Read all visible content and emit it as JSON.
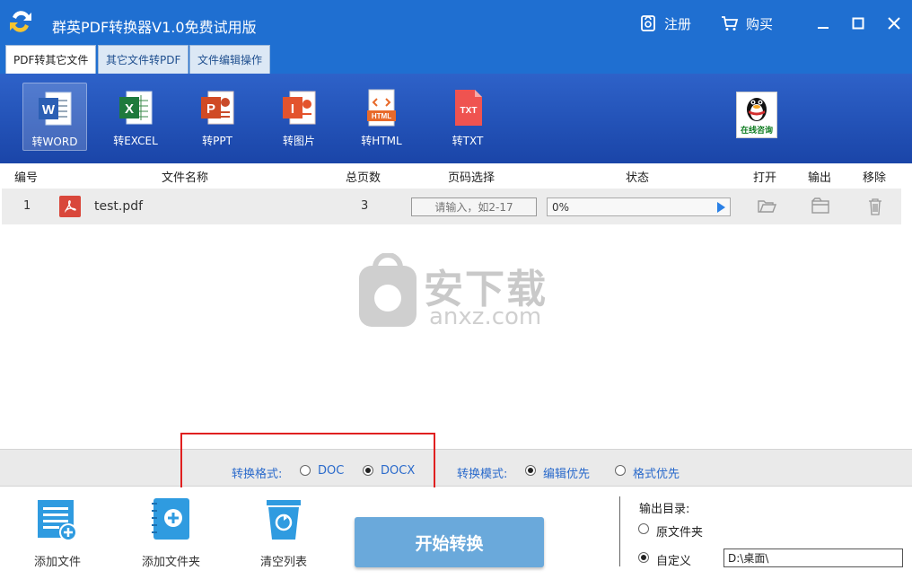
{
  "app": {
    "title": "群英PDF转换器V1.0免费试用版"
  },
  "titlebar": {
    "register_label": "注册",
    "buy_label": "购买"
  },
  "tabs": [
    {
      "label": "PDF转其它文件",
      "active": true
    },
    {
      "label": "其它文件转PDF",
      "active": false
    },
    {
      "label": "文件编辑操作",
      "active": false
    }
  ],
  "tools": [
    {
      "label": "转WORD",
      "icon": "word-icon",
      "active": true
    },
    {
      "label": "转EXCEL",
      "icon": "excel-icon"
    },
    {
      "label": "转PPT",
      "icon": "ppt-icon"
    },
    {
      "label": "转图片",
      "icon": "image-icon"
    },
    {
      "label": "转HTML",
      "icon": "html-icon"
    },
    {
      "label": "转TXT",
      "icon": "txt-icon"
    }
  ],
  "icon_text": {
    "word": "W",
    "excel": "X",
    "ppt": "P",
    "image": "I",
    "html": "HTML",
    "txt": "TXT"
  },
  "qq": {
    "label": "在线咨询"
  },
  "table": {
    "headers": {
      "no": "编号",
      "name": "文件名称",
      "pages": "总页数",
      "range": "页码选择",
      "status": "状态",
      "open": "打开",
      "output": "输出",
      "remove": "移除"
    },
    "rows": [
      {
        "no": "1",
        "name": "test.pdf",
        "pages": "3",
        "range_placeholder": "请输入，如2-17",
        "progress_text": "0%",
        "progress": 0
      }
    ]
  },
  "watermark": {
    "cn": "安下载",
    "en": "anxz.com"
  },
  "options": {
    "format_label": "转换格式:",
    "format_doc": "DOC",
    "format_docx": "DOCX",
    "format_selected": "DOCX",
    "mode_label": "转换模式:",
    "mode_edit": "编辑优先",
    "mode_layout": "格式优先",
    "mode_selected": "编辑优先"
  },
  "bottom": {
    "add_file": "添加文件",
    "add_folder": "添加文件夹",
    "clear_list": "清空列表",
    "start": "开始转换",
    "output_dir_label": "输出目录:",
    "original_folder": "原文件夹",
    "custom": "自定义",
    "custom_path": "D:\\桌面\\",
    "output_selected": "自定义"
  },
  "colors": {
    "titlebar": "#1f6fd1",
    "toolbar": "#2e62c9",
    "accent_text": "#2a6acb",
    "start_button": "#6aa9db",
    "highlight": "#e02020"
  }
}
